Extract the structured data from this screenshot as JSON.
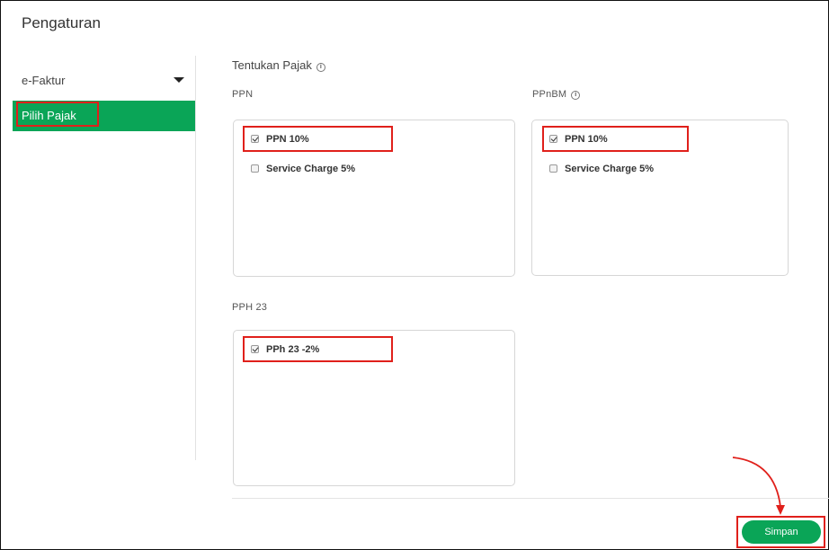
{
  "page": {
    "title": "Pengaturan"
  },
  "sidebar": {
    "items": [
      {
        "label": "e-Faktur",
        "icon": "caret-down-icon"
      },
      {
        "label": "Pilih Pajak",
        "selected": true
      }
    ]
  },
  "main": {
    "section_title": "Tentukan Pajak",
    "ppn": {
      "label": "PPN",
      "options": [
        {
          "label": "PPN 10%",
          "checked": true
        },
        {
          "label": "Service Charge 5%",
          "checked": false
        }
      ]
    },
    "ppnbm": {
      "label": "PPnBM",
      "options": [
        {
          "label": "PPN 10%",
          "checked": true
        },
        {
          "label": "Service Charge 5%",
          "checked": false
        }
      ]
    },
    "pph23": {
      "label": "PPH 23",
      "options": [
        {
          "label": "PPh 23 -2%",
          "checked": true
        }
      ]
    }
  },
  "footer": {
    "save_label": "Simpan"
  },
  "colors": {
    "accent": "#0aa557",
    "highlight": "#e0201b"
  }
}
